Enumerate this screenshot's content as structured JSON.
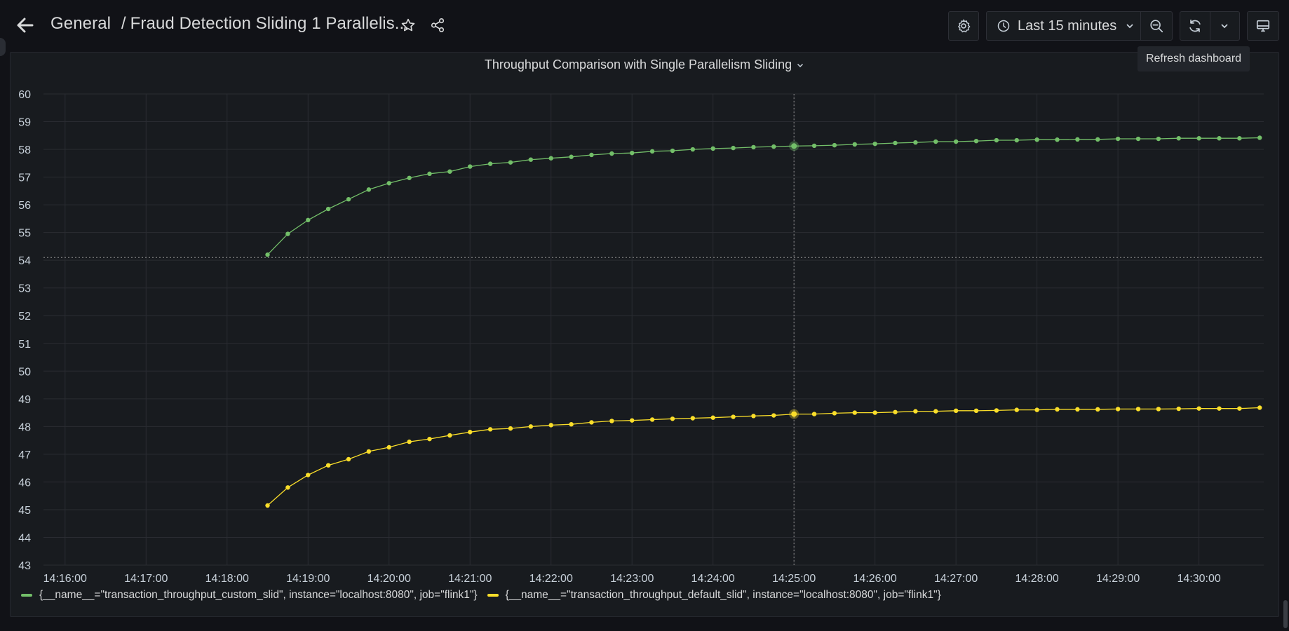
{
  "header": {
    "folder": "General",
    "separator": "/",
    "dashboard_title": "Fraud Detection Sliding 1 Parallelis..."
  },
  "toolbar": {
    "time_range": "Last 15 minutes"
  },
  "tooltip": {
    "text": "Refresh dashboard"
  },
  "panel": {
    "title": "Throughput Comparison with Single Parallelism Sliding"
  },
  "legend": [
    {
      "label": "{__name__=\"transaction_throughput_custom_slid\", instance=\"localhost:8080\", job=\"flink1\"}",
      "color": "#73bf69"
    },
    {
      "label": "{__name__=\"transaction_throughput_default_slid\", instance=\"localhost:8080\", job=\"flink1\"}",
      "color": "#fade2a"
    }
  ],
  "chart_data": {
    "type": "line",
    "ylim": [
      43,
      60
    ],
    "yticks": [
      43,
      44,
      45,
      46,
      47,
      48,
      49,
      50,
      51,
      52,
      53,
      54,
      55,
      56,
      57,
      58,
      59,
      60
    ],
    "xlim": [
      "14:15:44",
      "14:30:48"
    ],
    "xticks": [
      "14:16:00",
      "14:17:00",
      "14:18:00",
      "14:19:00",
      "14:20:00",
      "14:21:00",
      "14:22:00",
      "14:23:00",
      "14:24:00",
      "14:25:00",
      "14:26:00",
      "14:27:00",
      "14:28:00",
      "14:29:00",
      "14:30:00"
    ],
    "hover_time": "14:25:00",
    "hover_line_y": 54.1,
    "series": [
      {
        "name": "{__name__=\"transaction_throughput_custom_slid\", instance=\"localhost:8080\", job=\"flink1\"}",
        "color": "#73bf69",
        "times": [
          "14:18:30",
          "14:18:45",
          "14:19:00",
          "14:19:15",
          "14:19:30",
          "14:19:45",
          "14:20:00",
          "14:20:15",
          "14:20:30",
          "14:20:45",
          "14:21:00",
          "14:21:15",
          "14:21:30",
          "14:21:45",
          "14:22:00",
          "14:22:15",
          "14:22:30",
          "14:22:45",
          "14:23:00",
          "14:23:15",
          "14:23:30",
          "14:23:45",
          "14:24:00",
          "14:24:15",
          "14:24:30",
          "14:24:45",
          "14:25:00",
          "14:25:15",
          "14:25:30",
          "14:25:45",
          "14:26:00",
          "14:26:15",
          "14:26:30",
          "14:26:45",
          "14:27:00",
          "14:27:15",
          "14:27:30",
          "14:27:45",
          "14:28:00",
          "14:28:15",
          "14:28:30",
          "14:28:45",
          "14:29:00",
          "14:29:15",
          "14:29:30",
          "14:29:45",
          "14:30:00",
          "14:30:15",
          "14:30:30",
          "14:30:45"
        ],
        "values": [
          54.2,
          54.95,
          55.45,
          55.85,
          56.2,
          56.55,
          56.78,
          56.97,
          57.12,
          57.2,
          57.38,
          57.48,
          57.53,
          57.63,
          57.68,
          57.73,
          57.8,
          57.85,
          57.87,
          57.93,
          57.95,
          58.0,
          58.03,
          58.05,
          58.08,
          58.1,
          58.12,
          58.13,
          58.15,
          58.18,
          58.2,
          58.23,
          58.25,
          58.28,
          58.28,
          58.3,
          58.33,
          58.33,
          58.35,
          58.35,
          58.36,
          58.36,
          58.38,
          58.38,
          58.38,
          58.4,
          58.4,
          58.4,
          58.4,
          58.42
        ]
      },
      {
        "name": "{__name__=\"transaction_throughput_default_slid\", instance=\"localhost:8080\", job=\"flink1\"}",
        "color": "#fade2a",
        "times": [
          "14:18:30",
          "14:18:45",
          "14:19:00",
          "14:19:15",
          "14:19:30",
          "14:19:45",
          "14:20:00",
          "14:20:15",
          "14:20:30",
          "14:20:45",
          "14:21:00",
          "14:21:15",
          "14:21:30",
          "14:21:45",
          "14:22:00",
          "14:22:15",
          "14:22:30",
          "14:22:45",
          "14:23:00",
          "14:23:15",
          "14:23:30",
          "14:23:45",
          "14:24:00",
          "14:24:15",
          "14:24:30",
          "14:24:45",
          "14:25:00",
          "14:25:15",
          "14:25:30",
          "14:25:45",
          "14:26:00",
          "14:26:15",
          "14:26:30",
          "14:26:45",
          "14:27:00",
          "14:27:15",
          "14:27:30",
          "14:27:45",
          "14:28:00",
          "14:28:15",
          "14:28:30",
          "14:28:45",
          "14:29:00",
          "14:29:15",
          "14:29:30",
          "14:29:45",
          "14:30:00",
          "14:30:15",
          "14:30:30",
          "14:30:45"
        ],
        "values": [
          45.15,
          45.8,
          46.25,
          46.6,
          46.82,
          47.1,
          47.25,
          47.45,
          47.55,
          47.68,
          47.8,
          47.9,
          47.93,
          48.0,
          48.05,
          48.08,
          48.15,
          48.2,
          48.22,
          48.25,
          48.28,
          48.3,
          48.32,
          48.35,
          48.38,
          48.4,
          48.45,
          48.45,
          48.48,
          48.5,
          48.5,
          48.52,
          48.55,
          48.55,
          48.57,
          48.57,
          48.58,
          48.6,
          48.6,
          48.62,
          48.62,
          48.62,
          48.63,
          48.63,
          48.63,
          48.64,
          48.65,
          48.65,
          48.65,
          48.68
        ]
      }
    ]
  }
}
